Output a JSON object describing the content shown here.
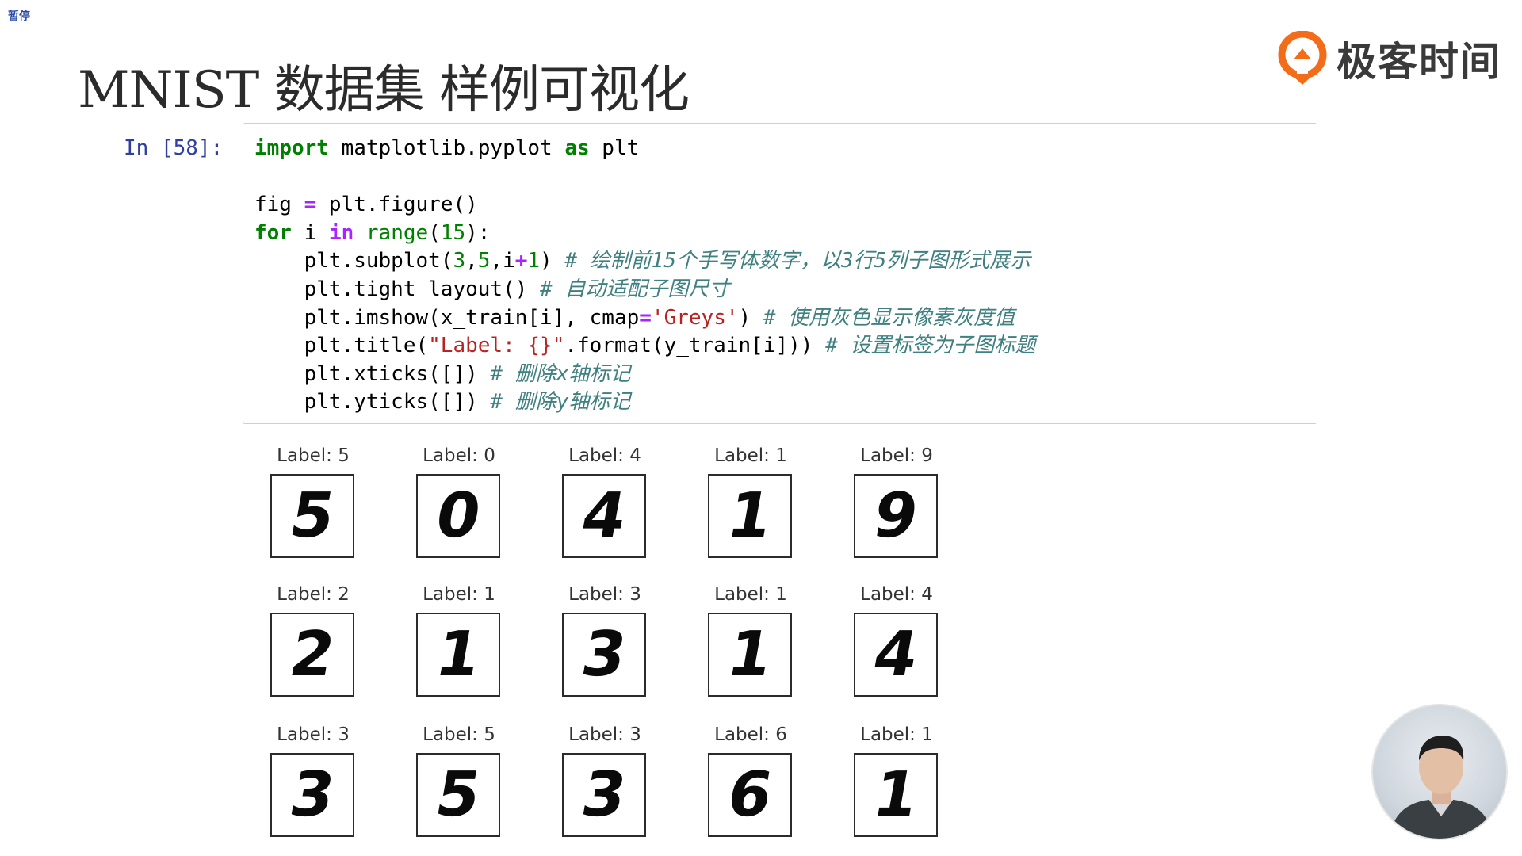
{
  "pause_badge": "暂停",
  "slide": {
    "title": "MNIST 数据集 样例可视化"
  },
  "brand": {
    "name": "极客时间",
    "accent": "#f26c1a"
  },
  "cell": {
    "prompt": "In [58]:"
  },
  "code_lines": [
    "import matplotlib.pyplot as plt",
    "",
    "fig = plt.figure()",
    "for i in range(15):",
    "    plt.subplot(3,5,i+1) # 绘制前15个手写体数字，以3行5列子图形式展示",
    "    plt.tight_layout() # 自动适配子图尺寸",
    "    plt.imshow(x_train[i], cmap='Greys') # 使用灰色显示像素灰度值",
    "    plt.title(\"Label: {}\".format(y_train[i])) # 设置标签为子图标题",
    "    plt.xticks([]) # 删除x轴标记",
    "    plt.yticks([]) # 删除y轴标记"
  ],
  "output": {
    "tiles": [
      {
        "label": "Label: 5",
        "digit": "5"
      },
      {
        "label": "Label: 0",
        "digit": "0"
      },
      {
        "label": "Label: 4",
        "digit": "4"
      },
      {
        "label": "Label: 1",
        "digit": "1"
      },
      {
        "label": "Label: 9",
        "digit": "9"
      },
      {
        "label": "Label: 2",
        "digit": "2"
      },
      {
        "label": "Label: 1",
        "digit": "1"
      },
      {
        "label": "Label: 3",
        "digit": "3"
      },
      {
        "label": "Label: 1",
        "digit": "1"
      },
      {
        "label": "Label: 4",
        "digit": "4"
      },
      {
        "label": "Label: 3",
        "digit": "3"
      },
      {
        "label": "Label: 5",
        "digit": "5"
      },
      {
        "label": "Label: 3",
        "digit": "3"
      },
      {
        "label": "Label: 6",
        "digit": "6"
      },
      {
        "label": "Label: 1",
        "digit": "1"
      }
    ]
  }
}
